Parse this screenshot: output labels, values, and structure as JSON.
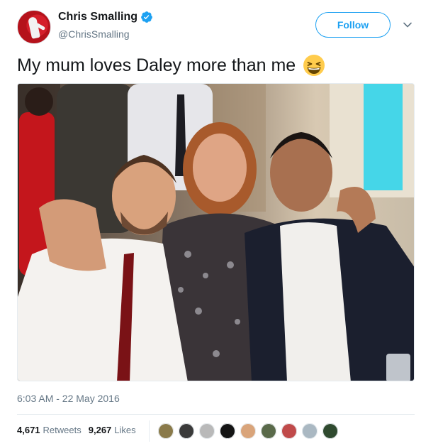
{
  "author": {
    "display_name": "Chris Smalling",
    "handle": "@ChrisSmalling",
    "verified": true
  },
  "follow_button_label": "Follow",
  "tweet": {
    "text": "My mum loves Daley more than me",
    "emoji": "grinning-squinting-face-icon",
    "timestamp": "6:03 AM - 22 May 2016"
  },
  "photo": {
    "alt": "photo"
  },
  "stats": {
    "retweets_count": "4,671",
    "retweets_label": "Retweets",
    "likes_count": "9,267",
    "likes_label": "Likes"
  },
  "likers": [
    {
      "color": "#8a7a4a"
    },
    {
      "color": "#3a3a3a"
    },
    {
      "color": "#b9b9b9"
    },
    {
      "color": "#141414"
    },
    {
      "color": "#d9a47a"
    },
    {
      "color": "#5a6a4a"
    },
    {
      "color": "#c04a4a"
    },
    {
      "color": "#aab8c2"
    },
    {
      "color": "#2f4a2f"
    }
  ],
  "colors": {
    "brand_blue": "#1da1f2",
    "text_primary": "#14171a",
    "text_secondary": "#657786"
  }
}
